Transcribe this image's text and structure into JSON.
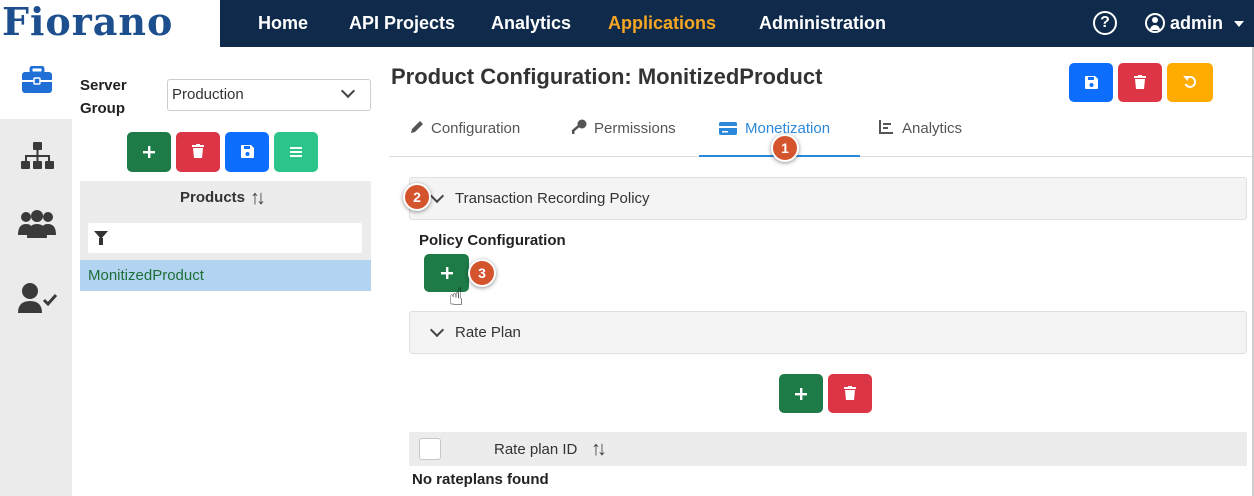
{
  "header": {
    "logo_text": "Fiorano",
    "nav": [
      "Home",
      "API Projects",
      "Analytics",
      "Applications",
      "Administration"
    ],
    "active_nav": "Applications",
    "help_glyph": "?",
    "user_label": "admin"
  },
  "rail": {
    "icons": [
      "briefcase-icon",
      "sitemap-icon",
      "users-icon",
      "user-check-icon"
    ],
    "active": "briefcase-icon"
  },
  "left_panel": {
    "server_group_label": "Server Group",
    "server_group_value": "Production",
    "buttons": [
      "add",
      "delete",
      "save",
      "menu"
    ],
    "products_title": "Products",
    "filter_placeholder": "",
    "items": [
      "MonitizedProduct"
    ]
  },
  "main": {
    "title": "Product Configuration: MonitizedProduct",
    "tabs": [
      {
        "label": "Configuration",
        "icon": "pencil-icon"
      },
      {
        "label": "Permissions",
        "icon": "key-icon"
      },
      {
        "label": "Monetization",
        "icon": "credit-card-icon"
      },
      {
        "label": "Analytics",
        "icon": "bar-chart-icon"
      }
    ],
    "active_tab": "Monetization",
    "transaction_policy_label": "Transaction Recording Policy",
    "policy_config_label": "Policy Configuration",
    "rate_plan_label": "Rate Plan",
    "table_column": "Rate plan ID",
    "empty_message": "No rateplans found"
  },
  "badges": [
    "1",
    "2",
    "3"
  ],
  "colors": {
    "topbar": "#0f2a4a",
    "active_nav": "#f5a623",
    "green": "#1e7a47",
    "red": "#dc3545",
    "blue": "#0d6efd",
    "teal": "#2bc48a",
    "orange": "#ffab00",
    "active_tab": "#2c88d9",
    "badge": "#d4542e"
  }
}
